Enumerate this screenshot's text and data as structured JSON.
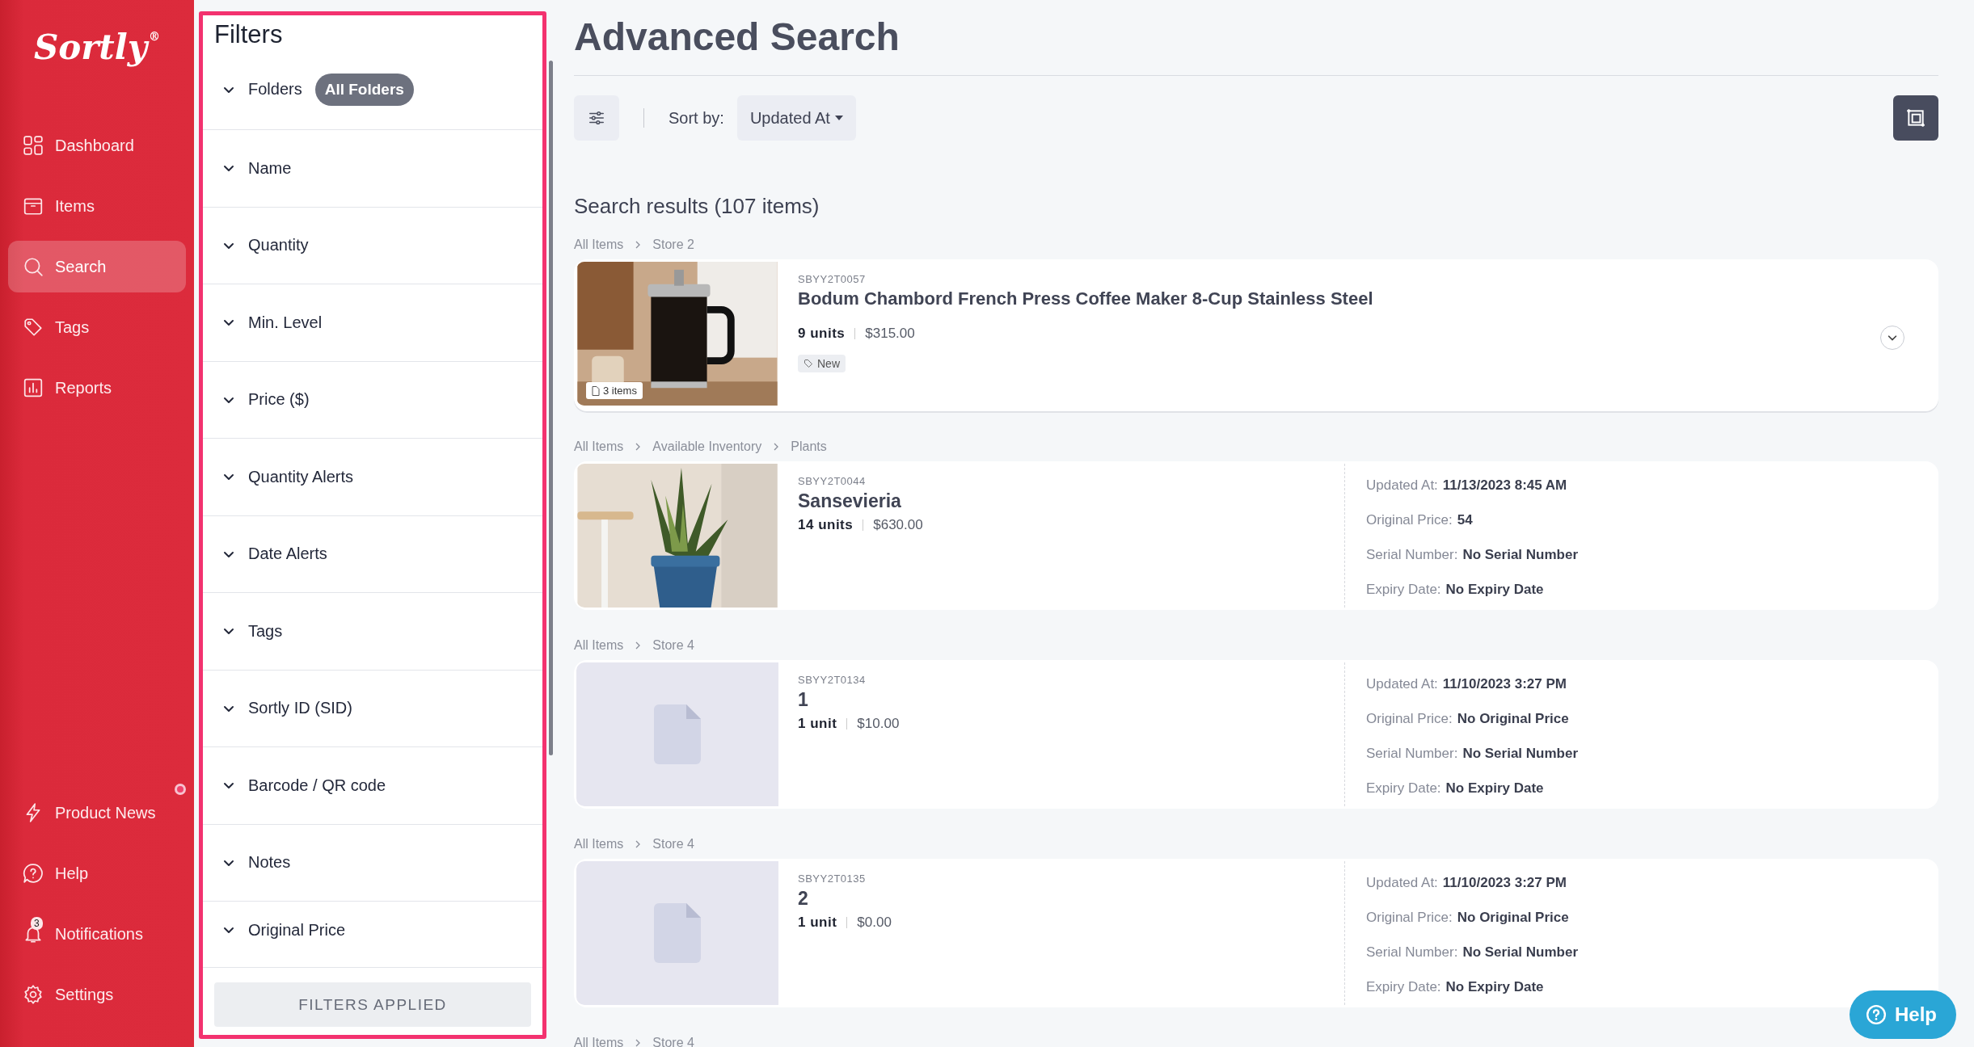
{
  "sidebar": {
    "logo": "Sortly",
    "logo_mark": "®",
    "nav": [
      {
        "label": "Dashboard",
        "selected": false
      },
      {
        "label": "Items",
        "selected": false
      },
      {
        "label": "Search",
        "selected": true
      },
      {
        "label": "Tags",
        "selected": false
      },
      {
        "label": "Reports",
        "selected": false
      }
    ],
    "bottom_nav": [
      {
        "label": "Product News",
        "dot": true
      },
      {
        "label": "Help"
      },
      {
        "label": "Notifications",
        "badge": "3"
      },
      {
        "label": "Settings"
      }
    ]
  },
  "filters": {
    "title": "Filters",
    "items": [
      {
        "label": "Folders",
        "value": "All Folders"
      },
      {
        "label": "Name"
      },
      {
        "label": "Quantity"
      },
      {
        "label": "Min. Level"
      },
      {
        "label": "Price ($)"
      },
      {
        "label": "Quantity Alerts"
      },
      {
        "label": "Date Alerts"
      },
      {
        "label": "Tags"
      },
      {
        "label": "Sortly ID (SID)"
      },
      {
        "label": "Barcode / QR code"
      },
      {
        "label": "Notes"
      },
      {
        "label": "Original Price"
      }
    ],
    "apply_button": "FILTERS APPLIED"
  },
  "main": {
    "title": "Advanced Search",
    "sort_label": "Sort by:",
    "sort_value": "Updated At",
    "results_heading": "Search results (107 items)",
    "results": [
      {
        "kind": "compact",
        "breadcrumb": [
          "All Items",
          "Store 2"
        ],
        "photo": true,
        "image_badge": "3 items",
        "sid": "SBYY2T0057",
        "name": "Bodum Chambord French Press Coffee Maker 8-Cup Stainless Steel",
        "units": "9 units",
        "price": "$315.00",
        "tags": [
          "New"
        ],
        "expanded": false
      },
      {
        "kind": "detailed",
        "breadcrumb": [
          "All Items",
          "Available Inventory",
          "Plants"
        ],
        "photo": true,
        "sid": "SBYY2T0044",
        "name": "Sansevieria",
        "units": "14 units",
        "price": "$630.00",
        "details": [
          {
            "label": "Updated At:",
            "value": "11/13/2023 8:45 AM"
          },
          {
            "label": "Original Price:",
            "value": "54"
          },
          {
            "label": "Serial Number:",
            "value": "No Serial Number"
          },
          {
            "label": "Expiry Date:",
            "value": "No Expiry Date"
          }
        ]
      },
      {
        "kind": "detailed",
        "breadcrumb": [
          "All Items",
          "Store 4"
        ],
        "photo": false,
        "sid": "SBYY2T0134",
        "name": "1",
        "units": "1 unit",
        "price": "$10.00",
        "details": [
          {
            "label": "Updated At:",
            "value": "11/10/2023 3:27 PM"
          },
          {
            "label": "Original Price:",
            "value": "No Original Price"
          },
          {
            "label": "Serial Number:",
            "value": "No Serial Number"
          },
          {
            "label": "Expiry Date:",
            "value": "No Expiry Date"
          }
        ]
      },
      {
        "kind": "detailed",
        "breadcrumb": [
          "All Items",
          "Store 4"
        ],
        "photo": false,
        "sid": "SBYY2T0135",
        "name": "2",
        "units": "1 unit",
        "price": "$0.00",
        "details": [
          {
            "label": "Updated At:",
            "value": "11/10/2023 3:27 PM"
          },
          {
            "label": "Original Price:",
            "value": "No Original Price"
          },
          {
            "label": "Serial Number:",
            "value": "No Serial Number"
          },
          {
            "label": "Expiry Date:",
            "value": "No Expiry Date"
          }
        ]
      },
      {
        "kind": "cut",
        "breadcrumb": [
          "All Items",
          "Store 4"
        ]
      }
    ],
    "help_button": "Help"
  }
}
